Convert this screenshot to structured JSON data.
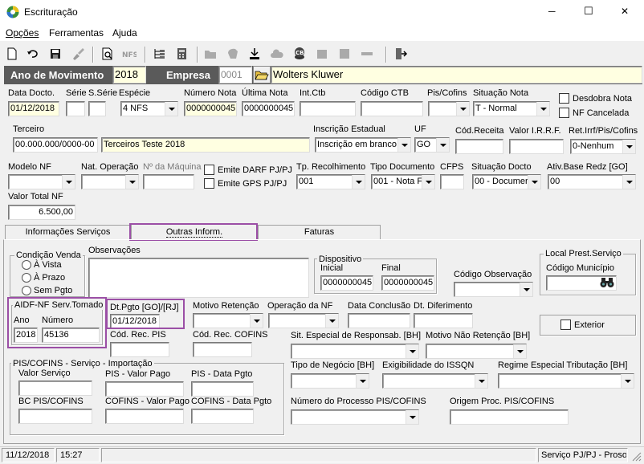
{
  "window": {
    "title": "Escrituração",
    "minimize": "─",
    "maximize": "☐",
    "close": "✕"
  },
  "menu": [
    "Opções",
    "Ferramentas",
    "Ajuda"
  ],
  "header": {
    "ano_label": "Ano de Movimento",
    "ano_value": "2018",
    "empresa_label": "Empresa",
    "empresa_code": "0001",
    "empresa_name": "Wolters Kluwer"
  },
  "row1": {
    "data_docto": {
      "label": "Data Docto.",
      "value": "01/12/2018"
    },
    "serie": {
      "label": "Série",
      "value": ""
    },
    "sserie": {
      "label": "S.Série",
      "value": ""
    },
    "especie": {
      "label": "Espécie",
      "value": "4 NFS"
    },
    "numero_nota": {
      "label": "Número Nota",
      "value": "0000000045"
    },
    "ultima_nota": {
      "label": "Última Nota",
      "value": "0000000045"
    },
    "int_ctb": {
      "label": "Int.Ctb",
      "value": ""
    },
    "codigo_ctb": {
      "label": "Código CTB",
      "value": ""
    },
    "pis_cofins": {
      "label": "Pis/Cofins",
      "value": ""
    },
    "situacao_nota": {
      "label": "Situação Nota",
      "value": "T - Normal"
    },
    "desdobra_nota": "Desdobra Nota",
    "nf_cancelada": "NF Cancelada"
  },
  "row2": {
    "terceiro": {
      "label": "Terceiro",
      "code": "00.000.000/0000-00",
      "name": "Terceiros Teste 2018"
    },
    "inscricao": {
      "label": "Inscrição Estadual",
      "value": "Inscrição em branco"
    },
    "uf": {
      "label": "UF",
      "value": "GO"
    },
    "cod_receita": {
      "label": "Cód.Receita",
      "value": ""
    },
    "valor_irrf": {
      "label": "Valor I.R.R.F.",
      "value": ""
    },
    "ret_irrf": {
      "label": "Ret.Irrf/Pis/Cofins",
      "value": "0-Nenhum"
    }
  },
  "row3": {
    "modelo_nf": {
      "label": "Modelo NF",
      "value": ""
    },
    "nat_operacao": {
      "label": "Nat. Operação",
      "value": ""
    },
    "num_maquina": {
      "label": "Nº da Máquina",
      "value": ""
    },
    "emite_darf": "Emite DARF PJ/PJ",
    "emite_gps": "Emite GPS PJ/PJ",
    "tp_recolhimento": {
      "label": "Tp. Recolhimento",
      "value": "001"
    },
    "tipo_documento": {
      "label": "Tipo Documento",
      "value": "001 - Nota F"
    },
    "cfps": {
      "label": "CFPS",
      "value": ""
    },
    "situacao_docto": {
      "label": "Situação Docto",
      "value": "00 - Documer"
    },
    "ativ_base": {
      "label": "Ativ.Base Redz [GO]",
      "value": "00"
    }
  },
  "valor_total": {
    "label": "Valor Total NF",
    "value": "6.500,00"
  },
  "tabs": [
    "Informações Serviços",
    "Outras Inform.",
    "Faturas"
  ],
  "condicao": {
    "title": "Condição Venda",
    "options": [
      "À Vista",
      "À Prazo",
      "Sem Pgto"
    ]
  },
  "observacoes": {
    "label": "Observações",
    "value": ""
  },
  "dispositivo": {
    "title": "Dispositivo",
    "inicial_label": "Inicial",
    "inicial_value": "0000000045",
    "final_label": "Final",
    "final_value": "0000000045"
  },
  "codigo_observacao": {
    "label": "Código Observação",
    "value": ""
  },
  "local_prest": {
    "title": "Local Prest.Serviço",
    "cod_municipio_label": "Código Município",
    "value": ""
  },
  "aidf": {
    "title": "AIDF-NF Serv.Tomado",
    "ano_label": "Ano",
    "ano_value": "2018",
    "numero_label": "Número",
    "numero_value": "45136"
  },
  "dt_pgto": {
    "label": "Dt.Pgto [GO]/[RJ]",
    "value": "01/12/2018"
  },
  "motivo_retencao": {
    "label": "Motivo Retenção",
    "value": ""
  },
  "operacao_nf": {
    "label": "Operação da NF",
    "value": ""
  },
  "data_conclusao": {
    "label": "Data Conclusão",
    "value": ""
  },
  "data_diferimento": {
    "label": "Dt. Diferimento",
    "value": ""
  },
  "exterior": "Exterior",
  "cod_rec_pis": {
    "label": "Cód. Rec. PIS",
    "value": ""
  },
  "cod_rec_cofins": {
    "label": "Cód. Rec. COFINS",
    "value": ""
  },
  "sit_especial": {
    "label": "Sit. Especial de Responsab. [BH]",
    "value": ""
  },
  "motivo_nao_retencao": {
    "label": "Motivo Não Retenção [BH]",
    "value": ""
  },
  "pis_cofins_group": {
    "title": "PIS/COFINS - Serviço - Importação",
    "valor_servico": "Valor Serviço",
    "pis_valor_pago": "PIS - Valor Pago",
    "pis_data_pgto": "PIS - Data Pgto",
    "bc_pis_cofins": "BC PIS/COFINS",
    "cofins_valor_pago": "COFINS - Valor Pago",
    "cofins_data_pgto": "COFINS - Data Pgto"
  },
  "tipo_negocio": {
    "label": "Tipo de Negócio [BH]",
    "value": ""
  },
  "exigibilidade": {
    "label": "Exigibilidade do ISSQN",
    "value": ""
  },
  "regime_especial": {
    "label": "Regime Especial Tributação [BH]",
    "value": ""
  },
  "numero_processo": {
    "label": "Número do Processo PIS/COFINS",
    "value": ""
  },
  "origem_proc": {
    "label": "Origem Proc. PIS/COFINS",
    "value": ""
  },
  "status": {
    "date": "11/12/2018",
    "time": "15:27",
    "module": "Serviço PJ/PJ - Prosoft"
  },
  "colors": {
    "header_bg": "#5a5a5a",
    "highlight": "#9b4fa6",
    "yellow_field": "#ffffe1"
  }
}
